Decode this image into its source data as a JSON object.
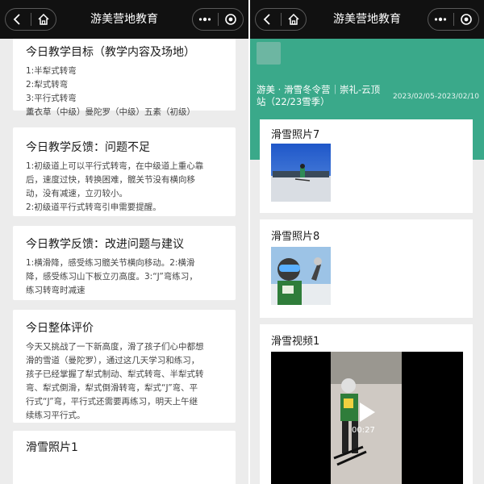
{
  "left": {
    "app_title": "游美营地教育",
    "goal": {
      "title": "今日教学目标（教学内容及场地）",
      "lines": [
        "1:半犁式转弯",
        "2:犁式转弯",
        "3:平行式转弯",
        "薰衣草（中级）曼陀罗（中级）五素（初级）"
      ]
    },
    "problems": {
      "title": "今日教学反馈：问题不足",
      "lines": [
        "1:初级道上可以平行式转弯，在中级道上重心靠",
        "后，速度过快，转换困难，髋关节没有横向移",
        "动，没有减速，立刃较小。",
        "2:初级道平行式转弯引申需要提醒。"
      ]
    },
    "suggestions": {
      "title": "今日教学反馈：改进问题与建议",
      "lines": [
        "1:横滑降，感受练习髋关节横向移动。2:横滑",
        "降，感受练习山下板立刃高度。3:“J”弯练习，",
        "练习转弯时减速"
      ]
    },
    "overall": {
      "title": "今日整体评价",
      "lines": [
        "今天又挑战了一下新高度，滑了孩子们心中都想",
        "滑的雪道（曼陀罗），通过这几天学习和练习，",
        "孩子已经掌握了犁式制动、犁式转弯、半犁式转",
        "弯、犁式倒滑，犁式倒滑转弯，犁式“J”弯、平",
        "行式“J”弯，平行式还需要再练习，明天上午继",
        "续练习平行式。"
      ]
    },
    "photo1_title": "滑雪照片1"
  },
  "right": {
    "app_title": "游美营地教育",
    "camp_title": "游美 · 滑雪冬令营｜崇礼-云顶站（22/23雪季）",
    "date_range": "2023/02/05-2023/02/10",
    "photo7_title": "滑雪照片7",
    "photo8_title": "滑雪照片8",
    "video_title": "滑雪视频1",
    "video_duration": "00:27"
  },
  "colors": {
    "accent": "#3aa98a",
    "titlebar": "#111111",
    "background": "#ececec"
  },
  "icons": [
    "back-icon",
    "home-icon",
    "more-icon",
    "close-icon",
    "play-icon"
  ]
}
